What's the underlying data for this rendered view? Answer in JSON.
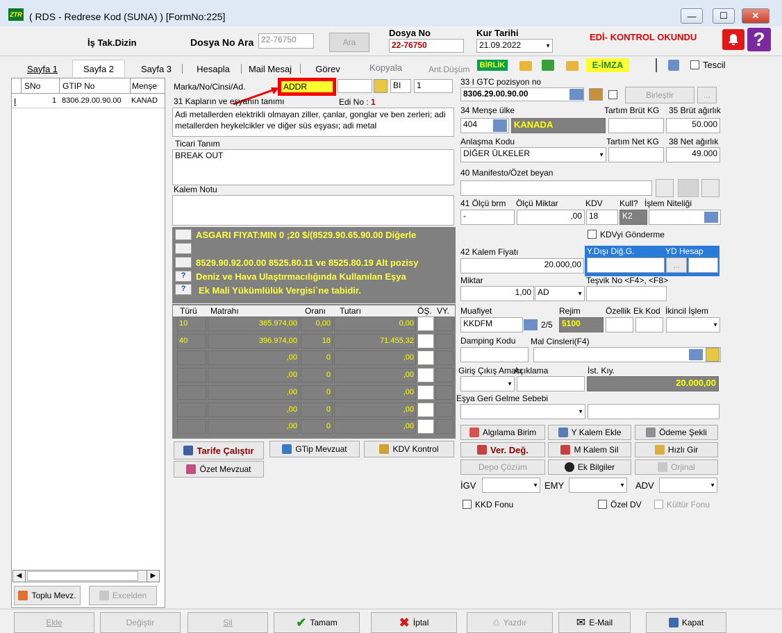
{
  "window": {
    "title": "( RDS - Redrese Kod (SUNA) ) [FormNo:225]",
    "app_icon_text": "ZTR",
    "minimize": "—",
    "maximize": "☐",
    "close": "✕"
  },
  "header": {
    "dizin_label": "İş Tak.Dizin",
    "dosya_no_ara_label": "Dosya No Ara",
    "dosya_no_ara_value": "22-76750",
    "ara_button": "Ara",
    "dosya_no_label": "Dosya No",
    "dosya_no_value": "22-76750",
    "kur_tarihi_label": "Kur Tarihi",
    "kur_tarihi_value": "21.09.2022",
    "status_text": "EDİ- KONTROL OKUNDU",
    "status_color": "#e00000"
  },
  "tabs": {
    "items": [
      "Sayfa 1",
      "Sayfa 2",
      "Sayfa 3",
      "Hesapla",
      "Mail Mesaj",
      "Görev"
    ],
    "kopyala": "Kopyala",
    "ant_dusum": "Ant.Düşüm",
    "birlik": "BİRLİK",
    "e_imza": "E-İMZA",
    "tescil": "Tescil"
  },
  "left_table": {
    "headers": [
      "SNo",
      "GTIP No",
      "Menşe"
    ],
    "rows": [
      {
        "marker": "I",
        "sno": "1",
        "gtip": "8306.29.00.90.00",
        "mense": "KANAD"
      }
    ],
    "toplu_mevz": "Toplu Mevz.",
    "excelden": "Excelden"
  },
  "middle": {
    "marka_label": "Marka/No/Cinsi/Ad.",
    "marka_value": "ADDR",
    "bi_value": "BI",
    "one_value": "1",
    "kaplar_label": "31 Kapların ve eşyanın tanımı",
    "edi_no_label": "Edi No :",
    "edi_no_value": "1",
    "tanim_text": "Adi metallerden elektrikli olmayan ziller, çanlar, gonglar ve ben zerleri; adi metallerden heykelcikler ve diğer süs eşyası; adi metal",
    "ticari_label": "Ticari Tanım",
    "ticari_value": "BREAK OUT",
    "kalem_notu_label": "Kalem Notu",
    "kalem_notu_value": "",
    "info_lines": [
      "ASGARI FIYAT:MIN 0 ;20 $/(8529.90.65.90.00    Diğerle",
      "",
      "8529.90.92.00.00     8525.80.11 ve 8525.80.19 Alt pozisy",
      "Deniz ve Hava Ulaştırmacılığında Kullanılan Eşya",
      "Ek Mali Yükümlülük Vergisi`ne tabidir."
    ],
    "info_q": "?"
  },
  "tax_grid": {
    "headers": [
      "Türü",
      "Matrahı",
      "Oranı",
      "Tutarı",
      "ÖŞ.",
      "VY."
    ],
    "rows": [
      [
        "10",
        "365.974,00",
        "0,00",
        "0,00"
      ],
      [
        "40",
        "396.974,00",
        "18",
        "71.455,32"
      ],
      [
        "",
        ",00",
        "0",
        ",00"
      ],
      [
        "",
        ",00",
        "0",
        ",00"
      ],
      [
        "",
        ",00",
        "0",
        ",00"
      ],
      [
        "",
        ",00",
        "0",
        ",00"
      ],
      [
        "",
        ",00",
        "0",
        ",00"
      ]
    ]
  },
  "middle_buttons": {
    "tarife": "Tarife Çalıştır",
    "gtip_mevzuat": "GTip Mevzuat",
    "kdv_kontrol": "KDV Kontrol",
    "ozet_mevzuat": "Özet Mevzuat"
  },
  "right": {
    "gtc_label": "33 I GTC pozisyon no",
    "gtc_value": "8306.29.00.90.00",
    "birlestir": "Birleştir",
    "mense_label": "34 Menşe ülke",
    "mense_code": "404",
    "mense_name": "KANADA",
    "tartim_brut_label": "Tartım Brüt KG",
    "brut_label": "35 Brüt ağırlık",
    "brut_value": "50.000",
    "anlasma_label": "Anlaşma Kodu",
    "anlasma_value": "DİĞER ÜLKELER",
    "tartim_net_label": "Tartım Net KG",
    "net_label": "38 Net ağırlık",
    "net_value": "49.000",
    "manifesto_label": "40 Manifesto/Özet beyan",
    "olcu_brm_label": "41 Ölçü brm",
    "olcu_brm_value": "-",
    "olcu_miktar_label": "Ölçü Miktar",
    "olcu_miktar_value": ",00",
    "kdv_label": "KDV",
    "kdv_value": "18",
    "kull_label": "Kull?",
    "kull_value": "K2",
    "islem_label": "İşlem Niteliği",
    "kdv_gonderme": "KDVyi Gönderme",
    "kalem_fiyati_label": "42 Kalem Fiyatı",
    "kalem_fiyati_value": "20.000,00",
    "ydisi_label": "Y.Dışı Diğ.G.",
    "yd_hesap_label": "YD Hesap",
    "miktar_label": "Miktar",
    "miktar_value": "1,00",
    "miktar_unit": "AD",
    "tesvik_label": "Teşvik No <F4>, <F8>",
    "muafiyet_label": "Muafiyet",
    "muafiyet_value": "KKDFM",
    "muafiyet_count": "2/5",
    "rejim_label": "Rejim",
    "rejim_value": "5100",
    "ozellik_label": "Özellik",
    "ek_kod_label": "Ek Kod",
    "ikincil_label": "İkincil İşlem",
    "damping_label": "Damping Kodu",
    "mal_cinsleri_label": "Mal Cinsleri(F4)",
    "giris_label": "Giriş Çıkış Amacı",
    "aciklama_label": "Açıklama",
    "ist_kiy_label": "İst. Kıy.",
    "ist_kiy_value": "20.000,00",
    "esya_label": "Eşya Geri Gelme Sebebi",
    "btn_algilama": "Algılama Birim",
    "btn_kalem_ekle": "Y Kalem Ekle",
    "btn_odeme": "Ödeme Şekli",
    "btn_ver_deg": "Ver. Değ.",
    "btn_kalem_sil": "M Kalem Sil",
    "btn_hizli": "Hızlı Gir",
    "btn_depo": "Depo Çözüm",
    "btn_ek_bilgiler": "Ek Bilgiler",
    "btn_orjinal": "Orjinal",
    "igv_label": "İGV",
    "emy_label": "EMY",
    "adv_label": "ADV",
    "kkd_fonu": "KKD Fonu",
    "ozel_dv": "Özel DV",
    "kultur_fonu": "Kültür Fonu"
  },
  "footer": {
    "ekle": "Ekle",
    "degistir": "Değiştir",
    "sil": "Sil",
    "tamam": "Tamam",
    "iptal": "İptal",
    "yazdir": "Yazdır",
    "email": "E-Mail",
    "kapat": "Kapat"
  }
}
